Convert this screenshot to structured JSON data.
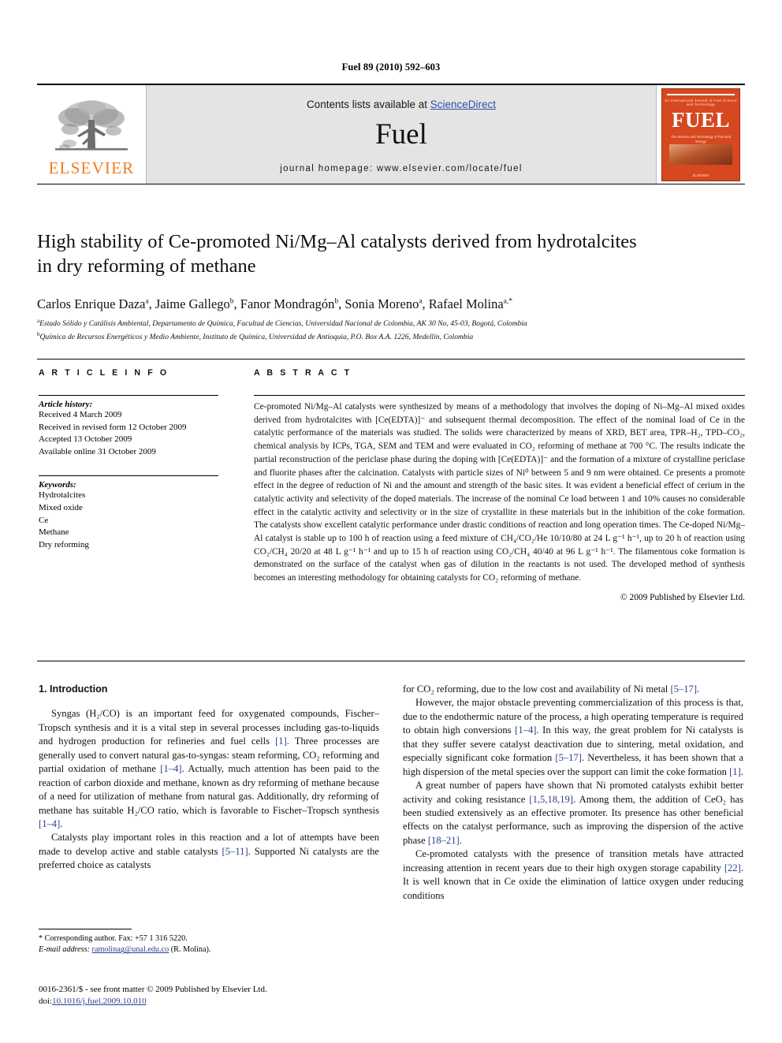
{
  "running_head": "Fuel 89 (2010) 592–603",
  "masthead": {
    "publisher_logo_text": "ELSEVIER",
    "contents_prefix": "Contents lists available at ",
    "contents_link": "ScienceDirect",
    "journal_name": "Fuel",
    "homepage": "journal homepage: www.elsevier.com/locate/fuel",
    "cover": {
      "tiny_top": "An International Journal of Fuel Science and Technology",
      "title": "FUEL",
      "subtitle": "The Science and Technology of Fuel and Energy",
      "footer": "ELSEVIER"
    }
  },
  "article": {
    "title_line1": "High stability of Ce-promoted Ni/Mg–Al catalysts derived from hydrotalcites",
    "title_line2": "in dry reforming of methane",
    "authors": [
      {
        "name": "Carlos Enrique Daza",
        "marks": "a"
      },
      {
        "name": "Jaime Gallego",
        "marks": "b"
      },
      {
        "name": "Fanor Mondragón",
        "marks": "b"
      },
      {
        "name": "Sonia Moreno",
        "marks": "a"
      },
      {
        "name": "Rafael Molina",
        "marks": "a,*"
      }
    ],
    "affiliations": [
      {
        "mark": "a",
        "text": "Estado Sólido y Catálisis Ambiental, Departamento de Química, Facultad de Ciencias, Universidad Nacional de Colombia, AK 30 No, 45-03, Bogotá, Colombia"
      },
      {
        "mark": "b",
        "text": "Química de Recursos Energéticos y Medio Ambiente, Instituto de Química, Universidad de Antioquia, P.O. Box A.A. 1226, Medellín, Colombia"
      }
    ]
  },
  "article_info": {
    "heading": "A R T I C L E   I N F O",
    "history_label": "Article history:",
    "history": [
      "Received 4 March 2009",
      "Received in revised form 12 October 2009",
      "Accepted 13 October 2009",
      "Available online 31 October 2009"
    ],
    "keywords_label": "Keywords:",
    "keywords": [
      "Hydrotalcites",
      "Mixed oxide",
      "Ce",
      "Methane",
      "Dry reforming"
    ]
  },
  "abstract": {
    "heading": "A B S T R A C T",
    "paragraphs": [
      "Ce-promoted Ni/Mg–Al catalysts were synthesized by means of a methodology that involves the doping of Ni–Mg–Al mixed oxides derived from hydrotalcites with [Ce(EDTA)]⁻ and subsequent thermal decomposition. The effect of the nominal load of Ce in the catalytic performance of the materials was studied. The solids were characterized by means of XRD, BET area, TPR–H₂, TPD–CO₂, chemical analysis by ICPs, TGA, SEM and TEM and were evaluated in CO₂ reforming of methane at 700 °C. The results indicate the partial reconstruction of the periclase phase during the doping with [Ce(EDTA)]⁻ and the formation of a mixture of crystalline periclase and fluorite phases after the calcination. Catalysts with particle sizes of Ni⁰ between 5 and 9 nm were obtained. Ce presents a promote effect in the degree of reduction of Ni and the amount and strength of the basic sites. It was evident a beneficial effect of cerium in the catalytic activity and selectivity of the doped materials. The increase of the nominal Ce load between 1 and 10% causes no considerable effect in the catalytic activity and selectivity or in the size of crystallite in these materials but in the inhibition of the coke formation. The catalysts show excellent catalytic performance under drastic conditions of reaction and long operation times. The Ce-doped Ni/Mg–Al catalyst is stable up to 100 h of reaction using a feed mixture of CH₄/CO₂/He 10/10/80 at 24 L g⁻¹ h⁻¹, up to 20 h of reaction using CO₂/CH₄ 20/20 at 48 L g⁻¹ h⁻¹ and up to 15 h of reaction using CO₂/CH₄ 40/40 at 96 L g⁻¹ h⁻¹. The filamentous coke formation is demonstrated on the surface of the catalyst when gas of dilution in the reactants is not used. The developed method of synthesis becomes an interesting methodology for obtaining catalysts for CO₂ reforming of methane."
    ],
    "copyright": "© 2009 Published by Elsevier Ltd."
  },
  "body": {
    "section_heading": "1. Introduction",
    "left_paragraphs": [
      "Syngas (H₂/CO) is an important feed for oxygenated compounds, Fischer–Tropsch synthesis and it is a vital step in several processes including gas-to-liquids and hydrogen production for refineries and fuel cells [1]. Three processes are generally used to convert natural gas-to-syngas: steam reforming, CO₂ reforming and partial oxidation of methane [1–4]. Actually, much attention has been paid to the reaction of carbon dioxide and methane, known as dry reforming of methane because of a need for utilization of methane from natural gas. Additionally, dry reforming of methane has suitable H₂/CO ratio, which is favorable to Fischer–Tropsch synthesis [1–4].",
      "Catalysts play important roles in this reaction and a lot of attempts have been made to develop active and stable catalysts [5–11]. Supported Ni catalysts are the preferred choice as catalysts"
    ],
    "right_paragraphs": [
      "for CO₂ reforming, due to the low cost and availability of Ni metal [5–17].",
      "However, the major obstacle preventing commercialization of this process is that, due to the endothermic nature of the process, a high operating temperature is required to obtain high conversions [1–4]. In this way, the great problem for Ni catalysts is that they suffer severe catalyst deactivation due to sintering, metal oxidation, and especially significant coke formation [5–17]. Nevertheless, it has been shown that a high dispersion of the metal species over the support can limit the coke formation [1].",
      "A great number of papers have shown that Ni promoted catalysts exhibit better activity and coking resistance [1,5,18,19]. Among them, the addition of CeO₂ has been studied extensively as an effective promoter. Its presence has other beneficial effects on the catalyst performance, such as improving the dispersion of the active phase [18–21].",
      "Ce-promoted catalysts with the presence of transition metals have attracted increasing attention in recent years due to their high oxygen storage capability [22]. It is well known that in Ce oxide the elimination of lattice oxygen under reducing conditions"
    ]
  },
  "footnote": {
    "corresponding": "* Corresponding author. Fax: +57 1 316 5220.",
    "email_label": "E-mail address:",
    "email": "ramolinag@unal.edu.co",
    "email_suffix": "(R. Molina)."
  },
  "imprint": {
    "line1": "0016-2361/$ - see front matter © 2009 Published by Elsevier Ltd.",
    "doi_label": "doi:",
    "doi": "10.1016/j.fuel.2009.10.010"
  },
  "colors": {
    "link": "#2b3f8c",
    "sciencedirect": "#2f4fa8",
    "elsevier_orange": "#f07d20",
    "cover_red": "#d6481f",
    "masthead_gray": "#e4e4e4"
  }
}
